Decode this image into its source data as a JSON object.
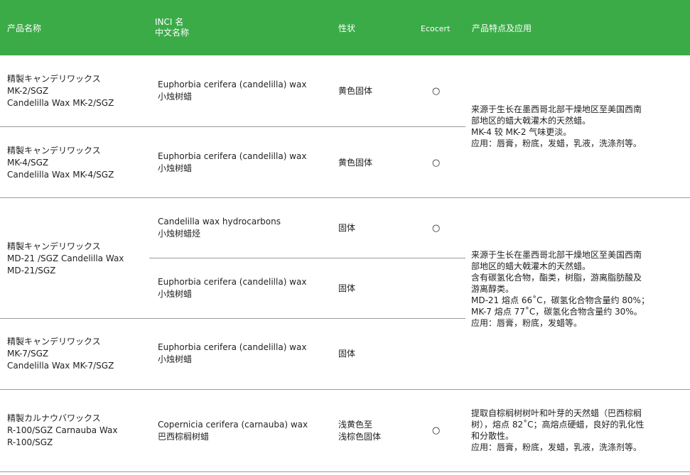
{
  "header": {
    "name": "产品名称",
    "inci": "INCI 名",
    "cn": "中文名称",
    "state": "性状",
    "ecocert": "Ecocert",
    "features": "产品特点及应用"
  },
  "rows": [
    {
      "name": [
        "精製キャンデリワックス",
        "MK-2/SGZ",
        "Candelilla Wax MK-2/SGZ"
      ],
      "inci": "Euphorbia cerifera (candelilla) wax",
      "cn": "小烛树蜡",
      "state": "黄色固体",
      "eco": "○"
    },
    {
      "name": [
        "精製キャンデリワックス",
        "MK-4/SGZ",
        "Candelilla Wax MK-4/SGZ"
      ],
      "inci": "Euphorbia cerifera (candelilla) wax",
      "cn": "小烛树蜡",
      "state": "黄色固体",
      "eco": "○"
    },
    {
      "name": [
        "精製キャンデリワックス",
        "MD-21 /SGZ Candelilla Wax",
        "MD-21/SGZ"
      ],
      "inci": "Candelilla wax hydrocarbons",
      "cn": "小烛树蜡烃",
      "state": "固体",
      "eco": "○",
      "inci2": "Euphorbia cerifera (candelilla) wax",
      "cn2": "小烛树蜡",
      "state2": "固体"
    },
    {
      "name": [
        "精製キャンデリワックス",
        "MK-7/SGZ",
        "Candelilla Wax MK-7/SGZ"
      ],
      "inci": "Euphorbia cerifera (candelilla) wax",
      "cn": "小烛树蜡",
      "state": "固体"
    },
    {
      "name": [
        "精製カルナウバワックス",
        "R-100/SGZ Carnauba Wax",
        "R-100/SGZ"
      ],
      "inci": "Copernicia cerifera (carnauba) wax",
      "cn": "巴西棕榈树蜡",
      "state": "浅黄色至",
      "state_b": "浅棕色固体",
      "eco": "○"
    }
  ],
  "features": {
    "group1": [
      "来源于生长在墨西哥北部干燥地区至美国西南",
      "部地区的蜡大戟灌木的天然蜡。",
      "MK-4 较 MK-2 气味更淡。",
      "应用：唇膏，粉底，发蜡，乳液，洗涤剂等。"
    ],
    "group2": [
      "来源于生长在墨西哥北部干燥地区至美国西南",
      "部地区的蜡大戟灌木的天然蜡。",
      "含有碳氢化合物，酯类，树脂，游离脂肪酸及",
      "游离醇类。",
      "MD-21 熔点 66˚C，碳氢化合物含量约 80%；",
      "MK-7 熔点 77˚C，碳氢化合物含量约 30%。",
      "应用：唇膏，粉底，发蜡等。"
    ],
    "group3": [
      "提取自棕榈树树叶和叶芽的天然蜡（巴西棕榈",
      "树），熔点 82˚C；高熔点硬蜡，良好的乳化性",
      "和分散性。",
      "应用：唇膏，粉底，发蜡，乳液，洗涤剂等。"
    ]
  }
}
